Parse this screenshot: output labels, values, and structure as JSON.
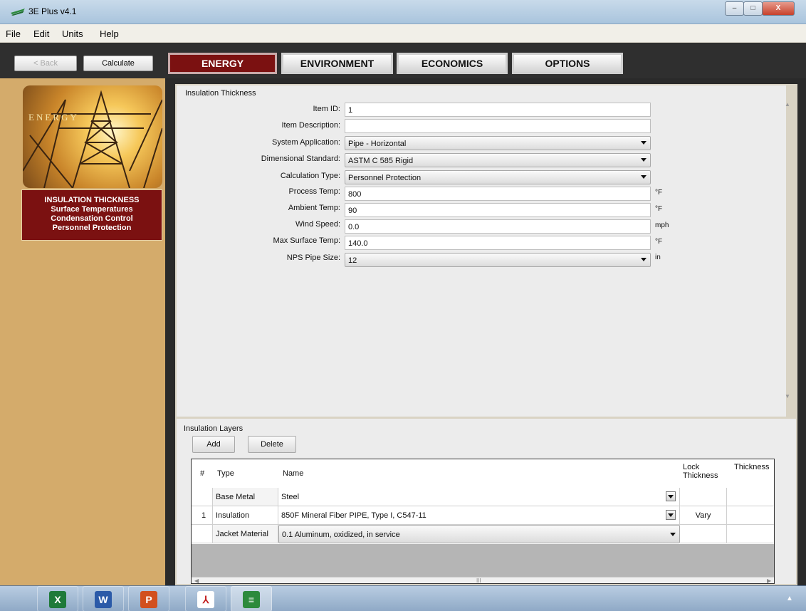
{
  "window": {
    "title": "3E Plus v4.1",
    "minimize": "–",
    "maximize": "□",
    "close": "X"
  },
  "menu": [
    "File",
    "Edit",
    "Units",
    "Help"
  ],
  "toolbar": {
    "back_label": "< Back",
    "calculate_label": "Calculate"
  },
  "tabs": [
    "ENERGY",
    "ENVIRONMENT",
    "ECONOMICS",
    "OPTIONS"
  ],
  "sidebar": {
    "banner_text": "ENERGY",
    "links": [
      "INSULATION THICKNESS",
      "Surface Temperatures",
      "Condensation Control",
      "Personnel Protection"
    ]
  },
  "form": {
    "title": "Insulation Thickness",
    "item_id": {
      "label": "Item ID:",
      "value": "1"
    },
    "item_description": {
      "label": "Item Description:",
      "value": ""
    },
    "system_application": {
      "label": "System Application:",
      "value": "Pipe - Horizontal"
    },
    "dimensional_standard": {
      "label": "Dimensional Standard:",
      "value": "ASTM C 585 Rigid"
    },
    "calculation_type": {
      "label": "Calculation Type:",
      "value": "Personnel Protection"
    },
    "process_temp": {
      "label": "Process Temp:",
      "value": "800",
      "unit": "°F"
    },
    "ambient_temp": {
      "label": "Ambient Temp:",
      "value": "90",
      "unit": "°F"
    },
    "wind_speed": {
      "label": "Wind Speed:",
      "value": "0.0",
      "unit": "mph"
    },
    "max_surface_temp": {
      "label": "Max Surface Temp:",
      "value": "140.0",
      "unit": "°F"
    },
    "nps_pipe_size": {
      "label": "NPS Pipe Size:",
      "value": "12",
      "unit": "in"
    }
  },
  "layers": {
    "title": "Insulation Layers",
    "add_label": "Add",
    "delete_label": "Delete",
    "columns": {
      "num": "#",
      "type": "Type",
      "name": "Name",
      "lock": "Lock Thickness",
      "thickness": "Thickness"
    },
    "rows": [
      {
        "num": "",
        "type": "Base Metal",
        "name": "Steel",
        "lock": ""
      },
      {
        "num": "1",
        "type": "Insulation",
        "name": "850F Mineral Fiber PIPE, Type I, C547-11",
        "lock": "Vary"
      },
      {
        "num": "",
        "type": "Jacket Material",
        "name": "0.1 Aluminum, oxidized, in service",
        "lock": ""
      }
    ],
    "scroll_label": "III"
  },
  "taskbar": {
    "apps": [
      {
        "icon": "excel-icon",
        "glyph": "X"
      },
      {
        "icon": "word-icon",
        "glyph": "W"
      },
      {
        "icon": "powerpoint-icon",
        "glyph": "P"
      },
      {
        "icon": "pdf-icon",
        "glyph": "⅄"
      },
      {
        "icon": "3eplus-icon",
        "glyph": "≡"
      }
    ]
  },
  "colors": {
    "accent": "#7b1111",
    "sidebar_bg": "#d4ab6b"
  }
}
